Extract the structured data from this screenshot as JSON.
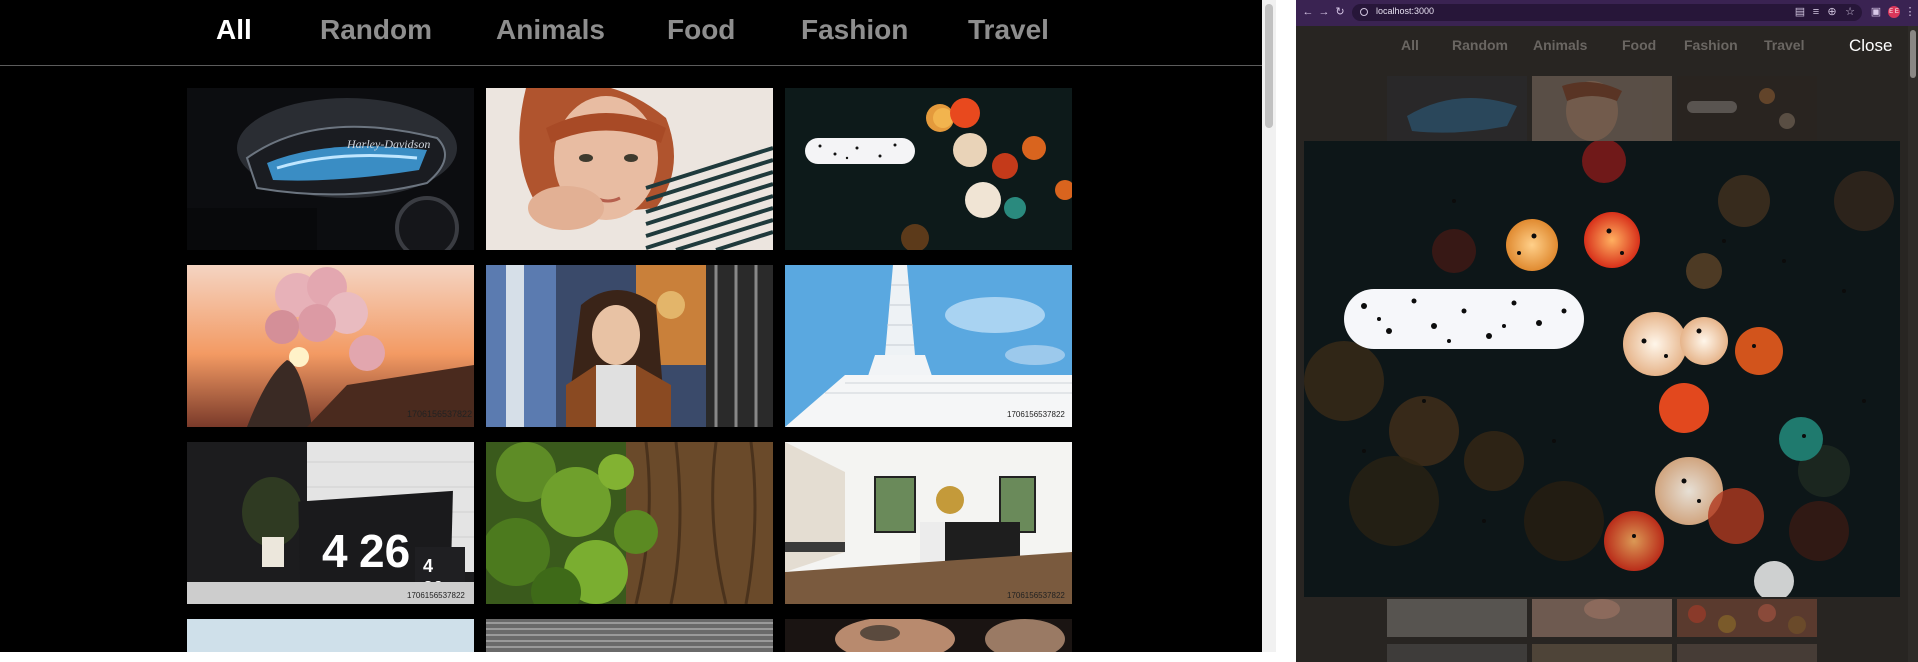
{
  "nav": {
    "items": [
      {
        "label": "All",
        "active": true
      },
      {
        "label": "Random",
        "active": false
      },
      {
        "label": "Animals",
        "active": false
      },
      {
        "label": "Food",
        "active": false
      },
      {
        "label": "Fashion",
        "active": false
      },
      {
        "label": "Travel",
        "active": false
      }
    ]
  },
  "gallery": {
    "photos": [
      {
        "subject": "motorcycle tank",
        "timestamp": ""
      },
      {
        "subject": "red-haired woman portrait",
        "timestamp": ""
      },
      {
        "subject": "bokeh rain city lights",
        "timestamp": ""
      },
      {
        "subject": "sunset with balloons",
        "timestamp": "1706156537822"
      },
      {
        "subject": "girl by graffiti wall",
        "timestamp": ""
      },
      {
        "subject": "white tower blue sky",
        "timestamp": "1706156537822"
      },
      {
        "subject": "laptop with clock display",
        "timestamp": "1706156537822"
      },
      {
        "subject": "mossy tree trunk",
        "timestamp": ""
      },
      {
        "subject": "modern kitchen",
        "timestamp": "1706156537822"
      },
      {
        "subject": "light blue",
        "timestamp": ""
      },
      {
        "subject": "grey stripes",
        "timestamp": ""
      },
      {
        "subject": "tattooed hand",
        "timestamp": ""
      }
    ]
  },
  "browser": {
    "url": "localhost:3000",
    "profile_initials": "E E",
    "close_label": "Close",
    "dim_nav": [
      "All",
      "Random",
      "Animals",
      "Food",
      "Fashion",
      "Travel"
    ]
  },
  "colors": {
    "background": "#000000",
    "nav_active": "#ffffff",
    "nav_inactive": "#8e8e8e",
    "browser_frame": "#3a2352"
  }
}
